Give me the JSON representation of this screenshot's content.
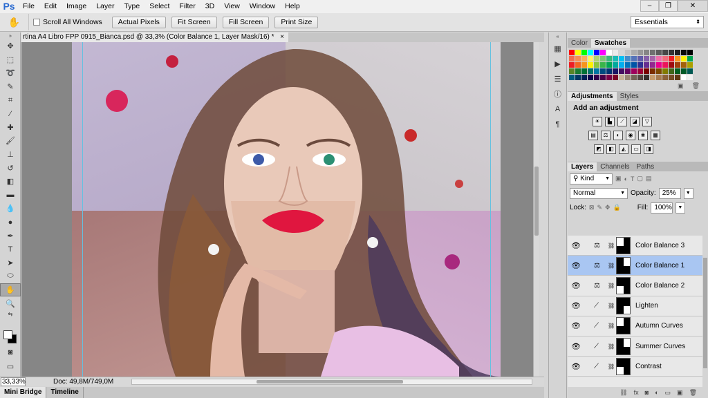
{
  "app": {
    "logo": "Ps"
  },
  "menu": [
    "File",
    "Edit",
    "Image",
    "Layer",
    "Type",
    "Select",
    "Filter",
    "3D",
    "View",
    "Window",
    "Help"
  ],
  "window_controls": [
    "–",
    "❐",
    "✕"
  ],
  "options_bar": {
    "scroll_all_windows": "Scroll All Windows",
    "actual_pixels": "Actual Pixels",
    "fit_screen": "Fit Screen",
    "fill_screen": "Fill Screen",
    "print_size": "Print Size",
    "workspace": "Essentials"
  },
  "document": {
    "tab_title": "rtina A4 Libro FPP 0915_Bianca.psd @ 33,3% (Color Balance 1, Layer Mask/16) *",
    "close": "×"
  },
  "status": {
    "zoom": "33,33%",
    "doc_info": "Doc: 49,8M/749,0M"
  },
  "bottom_tabs": [
    "Mini Bridge",
    "Timeline"
  ],
  "panels": {
    "color_tabs": [
      "Color",
      "Swatches"
    ],
    "adjust_tabs": [
      "Adjustments",
      "Styles"
    ],
    "adjust_title": "Add an adjustment",
    "layer_tabs": [
      "Layers",
      "Channels",
      "Paths"
    ],
    "kind": "Kind",
    "blend_mode": "Normal",
    "opacity_label": "Opacity:",
    "opacity_value": "25%",
    "lock_label": "Lock:",
    "fill_label": "Fill:",
    "fill_value": "100%"
  },
  "layers": [
    {
      "name": "Color Balance 3",
      "type": "balance",
      "selected": false
    },
    {
      "name": "Color Balance 1",
      "type": "balance",
      "selected": true
    },
    {
      "name": "Color Balance 2",
      "type": "balance",
      "selected": false
    },
    {
      "name": "Lighten",
      "type": "curves",
      "selected": false
    },
    {
      "name": "Autumn Curves",
      "type": "curves",
      "selected": false
    },
    {
      "name": "Summer Curves",
      "type": "curves",
      "selected": false
    },
    {
      "name": "Contrast",
      "type": "curves",
      "selected": false
    }
  ],
  "swatch_colors": [
    "#ff0000",
    "#ffff00",
    "#00ff00",
    "#00ffff",
    "#0000ff",
    "#ff00ff",
    "#ffffff",
    "#ebebeb",
    "#d6d6d6",
    "#c2c2c2",
    "#adadad",
    "#999999",
    "#858585",
    "#707070",
    "#5c5c5c",
    "#474747",
    "#333333",
    "#1f1f1f",
    "#0a0a0a",
    "#000000",
    "#f26c4f",
    "#f68e55",
    "#fbaf5c",
    "#fff467",
    "#acd372",
    "#7cc576",
    "#3bb878",
    "#1abbb4",
    "#00bff3",
    "#438ccb",
    "#5574b9",
    "#605ca8",
    "#855fa8",
    "#a763a8",
    "#f06ea9",
    "#f26d7d",
    "#ed1c24",
    "#f7941d",
    "#fff200",
    "#00a651",
    "#ed1c24",
    "#f26522",
    "#f7941d",
    "#fff200",
    "#8dc63f",
    "#39b54a",
    "#00a651",
    "#00a99d",
    "#00aeef",
    "#0072bc",
    "#0054a6",
    "#2e3192",
    "#662d91",
    "#92278f",
    "#ec008c",
    "#ed145b",
    "#9e0b0f",
    "#a0410d",
    "#a3620a",
    "#aba000",
    "#598527",
    "#1a7b30",
    "#007236",
    "#00746b",
    "#0076a3",
    "#004b80",
    "#003471",
    "#1b1464",
    "#440e62",
    "#630460",
    "#9e005d",
    "#9e0039",
    "#790000",
    "#7b2e00",
    "#7d4900",
    "#827b00",
    "#406618",
    "#005e20",
    "#005826",
    "#005952",
    "#005b7f",
    "#003663",
    "#002157",
    "#0d004c",
    "#32004b",
    "#4b0049",
    "#7b0046",
    "#7a0026",
    "#c7b299",
    "#998675",
    "#736357",
    "#534741",
    "#37302d",
    "#c69c6d",
    "#a67c52",
    "#8c6239",
    "#754c24",
    "#603913",
    "#ffffff",
    "#f0f0f0"
  ]
}
